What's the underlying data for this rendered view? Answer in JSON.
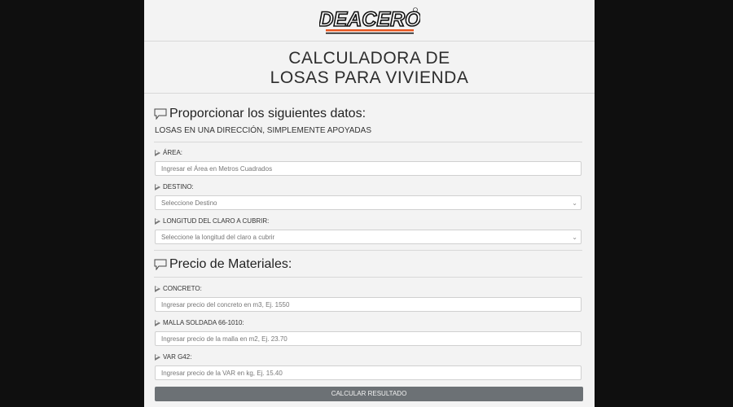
{
  "brand": {
    "logo_text": "DEACERO"
  },
  "header": {
    "title_line1": "CALCULADORA DE",
    "title_line2": "LOSAS PARA VIVIENDA"
  },
  "datos": {
    "heading": "Proporcionar los siguientes datos:",
    "subheading": "LOSAS EN UNA DIRECCIÓN, SIMPLEMENTE APOYADAS",
    "area_label": "ÁREA:",
    "area_placeholder": "Ingresar el Área en Metros Cuadrados",
    "destino_label": "DESTINO:",
    "destino_value": "Seleccione Destino",
    "longitud_label": "LONGITUD DEL CLARO A CUBRIR:",
    "longitud_value": "Seleccione la longitud del claro a cubrir"
  },
  "materiales": {
    "heading": "Precio de Materiales:",
    "concreto_label": "CONCRETO:",
    "concreto_placeholder": "Ingresar precio del concreto en m3, Ej. 1550",
    "malla_label": "MALLA SOLDADA 66-1010:",
    "malla_placeholder": "Ingresar precio de la malla en m2, Ej. 23.70",
    "var_label": "VAR G42:",
    "var_placeholder": "Ingresar precio de la VAR en kg, Ej. 15.40"
  },
  "actions": {
    "calculate_label": "CALCULAR RESULTADO"
  },
  "colors": {
    "logo_black": "#111111",
    "logo_orange": "#e8541e",
    "button": "#6c7175"
  }
}
